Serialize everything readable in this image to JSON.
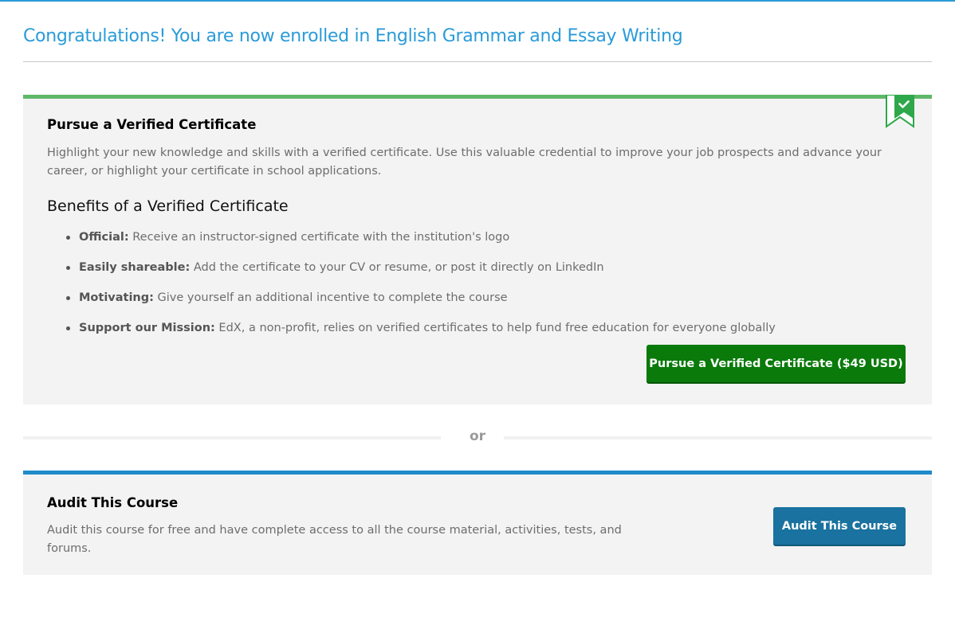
{
  "header": {
    "title": "Congratulations! You are now enrolled in English Grammar and Essay Writing"
  },
  "verified": {
    "title": "Pursue a Verified Certificate",
    "description": "Highlight your new knowledge and skills with a verified certificate. Use this valuable credential to improve your job prospects and advance your career, or highlight your certificate in school applications.",
    "ribbon_icon": "bookmark-check-icon",
    "benefits_title": "Benefits of a Verified Certificate",
    "benefits": [
      {
        "name": "Official:",
        "text": " Receive an instructor-signed certificate with the institution's logo"
      },
      {
        "name": "Easily shareable:",
        "text": " Add the certificate to your CV or resume, or post it directly on LinkedIn"
      },
      {
        "name": "Motivating:",
        "text": " Give yourself an additional incentive to complete the course"
      },
      {
        "name": "Support our Mission:",
        "text": " EdX, a non-profit, relies on verified certificates to help fund free education for everyone globally"
      }
    ],
    "button_label": "Pursue a Verified Certificate ($49 USD)"
  },
  "divider": {
    "label": "or"
  },
  "audit": {
    "title": "Audit This Course",
    "description": "Audit this course for free and have complete access to all the course material, activities, tests, and forums.",
    "button_label": "Audit This Course"
  },
  "colors": {
    "accent_blue": "#2a9bd8",
    "verified_green": "#5fb868",
    "verify_button": "#0a7a0a",
    "audit_border": "#1f8bc9",
    "audit_button": "#19729f",
    "panel_bg": "#f3f3f3"
  }
}
